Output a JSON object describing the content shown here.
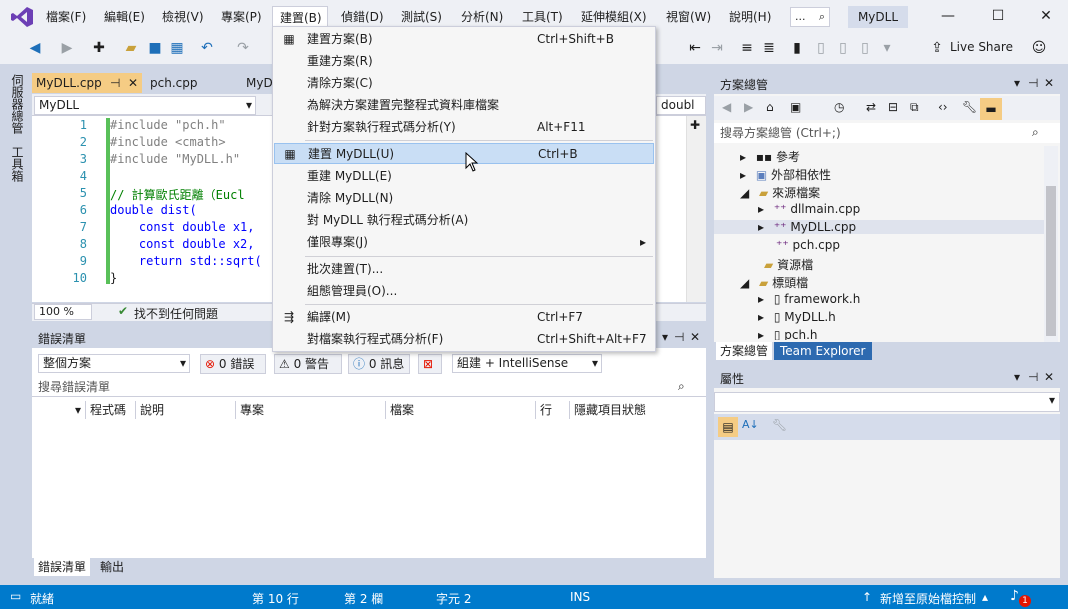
{
  "menubar": {
    "items": [
      "檔案(F)",
      "編輯(E)",
      "檢視(V)",
      "專案(P)",
      "建置(B)",
      "偵錯(D)",
      "測試(S)",
      "分析(N)",
      "工具(T)",
      "延伸模組(X)",
      "視窗(W)",
      "說明(H)"
    ],
    "search_label": "...",
    "solution_name": "MyDLL",
    "live_share": "Live Share"
  },
  "sidebar": {
    "tab1": "伺服器總管",
    "tab2": "工具箱"
  },
  "doc_tabs": {
    "active": "MyDLL.cpp",
    "tab2": "pch.cpp",
    "tab3": "MyD"
  },
  "editor": {
    "scope_combo": "MyDLL",
    "member_combo": "doubl",
    "lines": [
      {
        "n": "1",
        "t": "#include \"pch.h\""
      },
      {
        "n": "2",
        "t": "#include <cmath>"
      },
      {
        "n": "3",
        "t": "#include \"MyDLL.h\""
      },
      {
        "n": "4",
        "t": ""
      },
      {
        "n": "5",
        "t": "// 計算歐氏距離（Eucl"
      },
      {
        "n": "6",
        "t": "double dist("
      },
      {
        "n": "7",
        "t": "    const double x1,"
      },
      {
        "n": "8",
        "t": "    const double x2,"
      },
      {
        "n": "9",
        "t": "    return std::sqrt("
      },
      {
        "n": "10",
        "t": "}"
      }
    ],
    "zoom": "100 %",
    "issues": "找不到任何問題"
  },
  "error_list": {
    "title": "錯誤清單",
    "scope": "整個方案",
    "errors": "0 錯誤",
    "warnings": "0 警告",
    "messages": "0 訊息",
    "build_filter": "組建 + IntelliSense",
    "search_placeholder": "搜尋錯誤清單",
    "columns": [
      "程式碼",
      "說明",
      "專案",
      "檔案",
      "行",
      "隱藏項目狀態"
    ],
    "tab_error_list": "錯誤清單",
    "tab_output": "輸出"
  },
  "solution_explorer": {
    "title": "方案總管",
    "search_placeholder": "搜尋方案總管 (Ctrl+;)",
    "tree": [
      {
        "label": "參考",
        "depth": 0
      },
      {
        "label": "外部相依性",
        "depth": 0
      },
      {
        "label": "來源檔案",
        "depth": 0
      },
      {
        "label": "dllmain.cpp",
        "depth": 1
      },
      {
        "label": "MyDLL.cpp",
        "depth": 1
      },
      {
        "label": "pch.cpp",
        "depth": 1
      },
      {
        "label": "資源檔",
        "depth": 0
      },
      {
        "label": "標頭檔",
        "depth": 0
      },
      {
        "label": "framework.h",
        "depth": 1
      },
      {
        "label": "MyDLL.h",
        "depth": 1
      },
      {
        "label": "pch.h",
        "depth": 1
      }
    ],
    "tab_solution": "方案總管",
    "tab_team": "Team Explorer"
  },
  "properties": {
    "title": "屬性"
  },
  "build_menu": {
    "items": [
      {
        "label": "建置方案(B)",
        "shortcut": "Ctrl+Shift+B"
      },
      {
        "label": "重建方案(R)",
        "shortcut": ""
      },
      {
        "label": "清除方案(C)",
        "shortcut": ""
      },
      {
        "label": "為解決方案建置完整程式資料庫檔案",
        "shortcut": ""
      },
      {
        "label": "針對方案執行程式碼分析(Y)",
        "shortcut": "Alt+F11"
      },
      {
        "label": "建置 MyDLL(U)",
        "shortcut": "Ctrl+B"
      },
      {
        "label": "重建 MyDLL(E)",
        "shortcut": ""
      },
      {
        "label": "清除 MyDLL(N)",
        "shortcut": ""
      },
      {
        "label": "對 MyDLL 執行程式碼分析(A)",
        "shortcut": ""
      },
      {
        "label": "僅限專案(J)",
        "shortcut": ""
      },
      {
        "label": "批次建置(T)...",
        "shortcut": ""
      },
      {
        "label": "組態管理員(O)...",
        "shortcut": ""
      },
      {
        "label": "編譯(M)",
        "shortcut": "Ctrl+F7"
      },
      {
        "label": "對檔案執行程式碼分析(F)",
        "shortcut": "Ctrl+Shift+Alt+F7"
      }
    ]
  },
  "statusbar": {
    "ready": "就緒",
    "line": "第 10 行",
    "col": "第 2 欄",
    "char": "字元 2",
    "ins": "INS",
    "source_control": "新增至原始檔控制",
    "notifications": "1"
  }
}
